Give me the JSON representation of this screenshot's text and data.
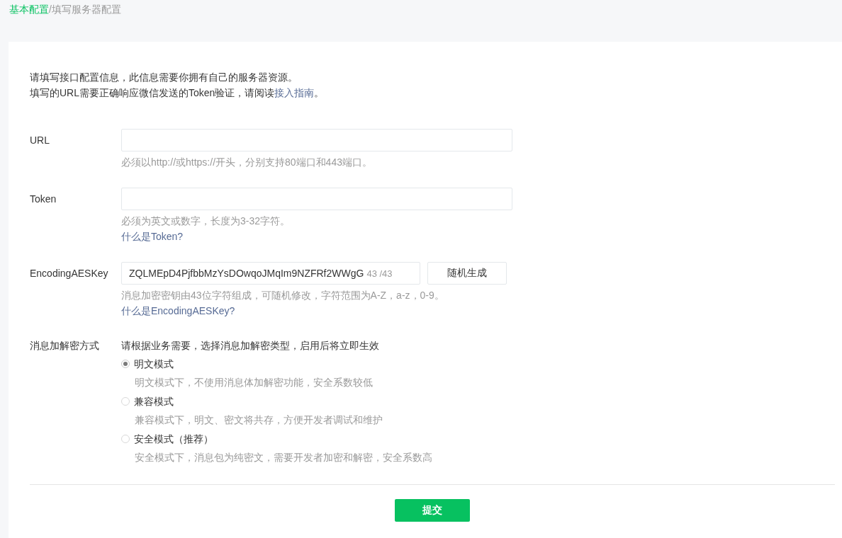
{
  "breadcrumb": {
    "parent": "基本配置",
    "separator": "/",
    "current": "填写服务器配置"
  },
  "intro": {
    "line_1": "请填写接口配置信息，此信息需要你拥有自己的服务器资源。",
    "line_2_before": "填写的URL需要正确响应微信发送的Token验证，请阅读",
    "line_2_link": "接入指南",
    "line_2_after": "。"
  },
  "fields": [
    {
      "kind": "text",
      "label": "URL",
      "hint": "必须以http://或https://开头，分别支持80端口和443端口。"
    },
    {
      "kind": "text",
      "label": "Token",
      "hint": "必须为英文或数字，长度为3-32字符。",
      "help_link": "什么是Token?"
    },
    {
      "kind": "key",
      "label": "EncodingAESKey",
      "value": "ZQLMEpD4PjfbbMzYsDOwqoJMqIm9NZFRf2WWgG",
      "counter": "43 /43",
      "button": "随机生成",
      "hint": "消息加密密钥由43位字符组成，可随机修改，字符范围为A-Z，a-z，0-9。",
      "help_link": "什么是EncodingAESKey?"
    }
  ],
  "encryption": {
    "label": "消息加解密方式",
    "instruction": "请根据业务需要，选择消息加解密类型，启用后将立即生效",
    "options": [
      {
        "label": "明文模式",
        "description": "明文模式下，不使用消息体加解密功能，安全系数较低",
        "selected": true
      },
      {
        "label": "兼容模式",
        "description": "兼容模式下，明文、密文将共存，方便开发者调试和维护",
        "selected": false
      },
      {
        "label": "安全模式（推荐）",
        "description": "安全模式下，消息包为纯密文，需要开发者加密和解密，安全系数高",
        "selected": false
      }
    ]
  },
  "submit": "提交"
}
